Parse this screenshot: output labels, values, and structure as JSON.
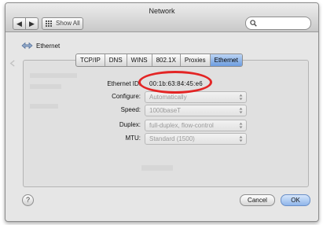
{
  "window": {
    "title": "Network"
  },
  "toolbar": {
    "back_glyph": "◀",
    "forward_glyph": "▶",
    "show_all_label": "Show All",
    "search_placeholder": ""
  },
  "section": {
    "label": "Ethernet",
    "icon": "ethernet-arrows-icon"
  },
  "tabs": [
    {
      "label": "TCP/IP",
      "active": false
    },
    {
      "label": "DNS",
      "active": false
    },
    {
      "label": "WINS",
      "active": false
    },
    {
      "label": "802.1X",
      "active": false
    },
    {
      "label": "Proxies",
      "active": false
    },
    {
      "label": "Ethernet",
      "active": true
    }
  ],
  "ethernet": {
    "id_label": "Ethernet ID:",
    "id_value": "00:1b:63:84:45:e6",
    "configure_label": "Configure:",
    "configure_value": "Automatically",
    "speed_label": "Speed:",
    "speed_value": "1000baseT",
    "duplex_label": "Duplex:",
    "duplex_value": "full-duplex, flow-control",
    "mtu_label": "MTU:",
    "mtu_value": "Standard  (1500)"
  },
  "buttons": {
    "help_glyph": "?",
    "cancel": "Cancel",
    "ok": "OK"
  },
  "colors": {
    "highlight_oval": "#e32525",
    "active_tab": "#6d9de0"
  }
}
